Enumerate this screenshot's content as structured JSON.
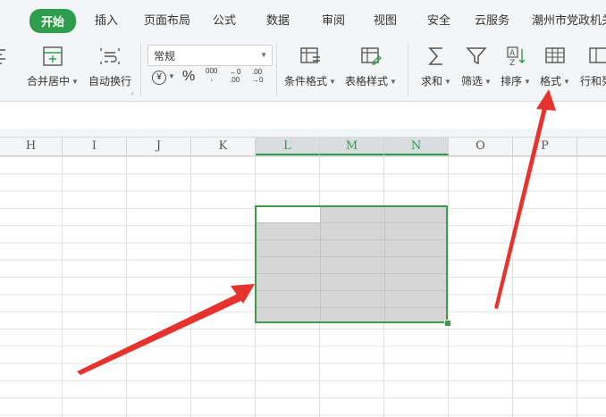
{
  "menu": {
    "tabs": [
      "开始",
      "插入",
      "页面布局",
      "公式",
      "数据",
      "审阅",
      "视图",
      "安全",
      "云服务",
      "潮州市党政机关"
    ]
  },
  "toolbar": {
    "merge_label": "合并居中",
    "wrap_label": "自动换行",
    "number_format_value": "常规",
    "currency_symbol": "¥",
    "percent_symbol": "%",
    "thousands_symbol": "000",
    "dec_increase": ".00",
    "dec_decrease": ".00",
    "conditional_format_label": "条件格式",
    "table_style_label": "表格样式",
    "sum_label": "求和",
    "filter_label": "筛选",
    "sort_label": "排序",
    "format_label": "格式",
    "rowcol_label": "行和列"
  },
  "sheet": {
    "columns": [
      "H",
      "I",
      "J",
      "K",
      "L",
      "M",
      "N",
      "O",
      "P"
    ],
    "selected_columns": [
      "L",
      "M",
      "N"
    ]
  },
  "colors": {
    "accent_green": "#2e9e4e",
    "selection_fill": "#d6d6d6",
    "arrow_red": "#e8322e"
  }
}
